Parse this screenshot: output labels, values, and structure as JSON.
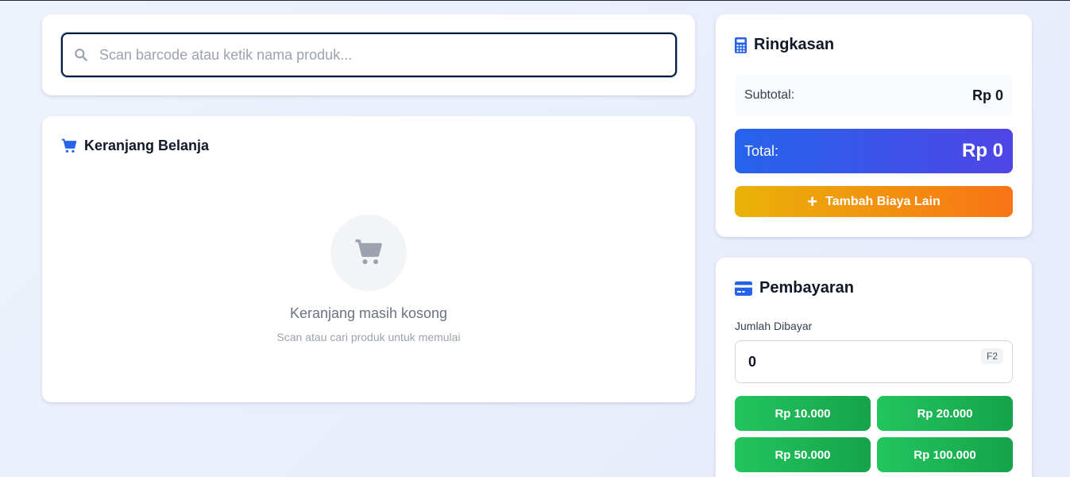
{
  "search": {
    "placeholder": "Scan barcode atau ketik nama produk...",
    "value": ""
  },
  "cart": {
    "title": "Keranjang Belanja",
    "empty_title": "Keranjang masih kosong",
    "empty_subtitle": "Scan atau cari produk untuk memulai"
  },
  "summary": {
    "title": "Ringkasan",
    "subtotal_label": "Subtotal:",
    "subtotal_value": "Rp 0",
    "total_label": "Total:",
    "total_value": "Rp 0",
    "extra_cost_button": "Tambah Biaya Lain"
  },
  "payment": {
    "title": "Pembayaran",
    "amount_label": "Jumlah Dibayar",
    "amount_value": "0",
    "shortcut": "F2",
    "quick_amounts": [
      "Rp 10.000",
      "Rp 20.000",
      "Rp 50.000",
      "Rp 100.000"
    ]
  },
  "colors": {
    "primary": "#2563eb",
    "total_gradient_end": "#4f46e5",
    "extra_gradient_start": "#eab308",
    "extra_gradient_end": "#f97316",
    "quick_green": "#22c55e"
  },
  "icons": {
    "search": "search-icon",
    "cart": "shopping-cart-icon",
    "summary": "calculator-icon",
    "payment": "credit-card-icon",
    "add": "plus-icon"
  }
}
